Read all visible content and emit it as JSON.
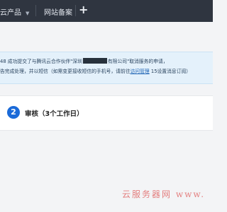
{
  "topbar": {
    "products_label": "云产品",
    "products_caret": "▼",
    "record_label": "网站备案",
    "add_label": "+"
  },
  "notice": {
    "line1_prefix": "48 成功提交了与腾讯云合作伙伴\"深圳",
    "line1_suffix": "有限公司\"取消服务的申请，",
    "line2_prefix": "告完成处理，并以短信（如需变更接收短信的手机号，请前往",
    "line2_link": "访问管理",
    "line2_suffix": " 15设置消息订阅）"
  },
  "step": {
    "number": "2",
    "title": "审核（3个工作日）"
  },
  "watermark": "云服务器网 www."
}
